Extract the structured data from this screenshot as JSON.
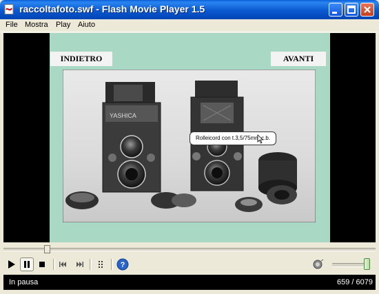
{
  "window": {
    "title": "raccoltafoto.swf - Flash Movie Player 1.5"
  },
  "menu": {
    "items": [
      "File",
      "Mostra",
      "Play",
      "Aiuto"
    ]
  },
  "stage": {
    "back_label": "INDIETRO",
    "next_label": "AVANTI",
    "tooltip": "Rolleicord con t.3,5/75mm c.b.",
    "camera_left_brand": "YASHICA"
  },
  "player": {
    "seek_fraction": 0.11,
    "volume_fraction": 1.0
  },
  "status": {
    "text": "In pausa",
    "frame_counter": "659 / 6079"
  },
  "icons": {
    "app": "flash-file-icon",
    "minimize": "minimize-icon",
    "maximize": "maximize-icon",
    "close": "close-icon",
    "play": "play-icon",
    "pause": "pause-icon",
    "stop": "stop-icon",
    "rewind": "skip-back-icon",
    "forward": "skip-forward-icon",
    "playlist": "playlist-icon",
    "help": "help-icon",
    "volume": "speaker-icon"
  },
  "colors": {
    "stage_bg": "#A9D8C5",
    "title_bar": "#0A58D0",
    "status_bg": "#000000"
  }
}
